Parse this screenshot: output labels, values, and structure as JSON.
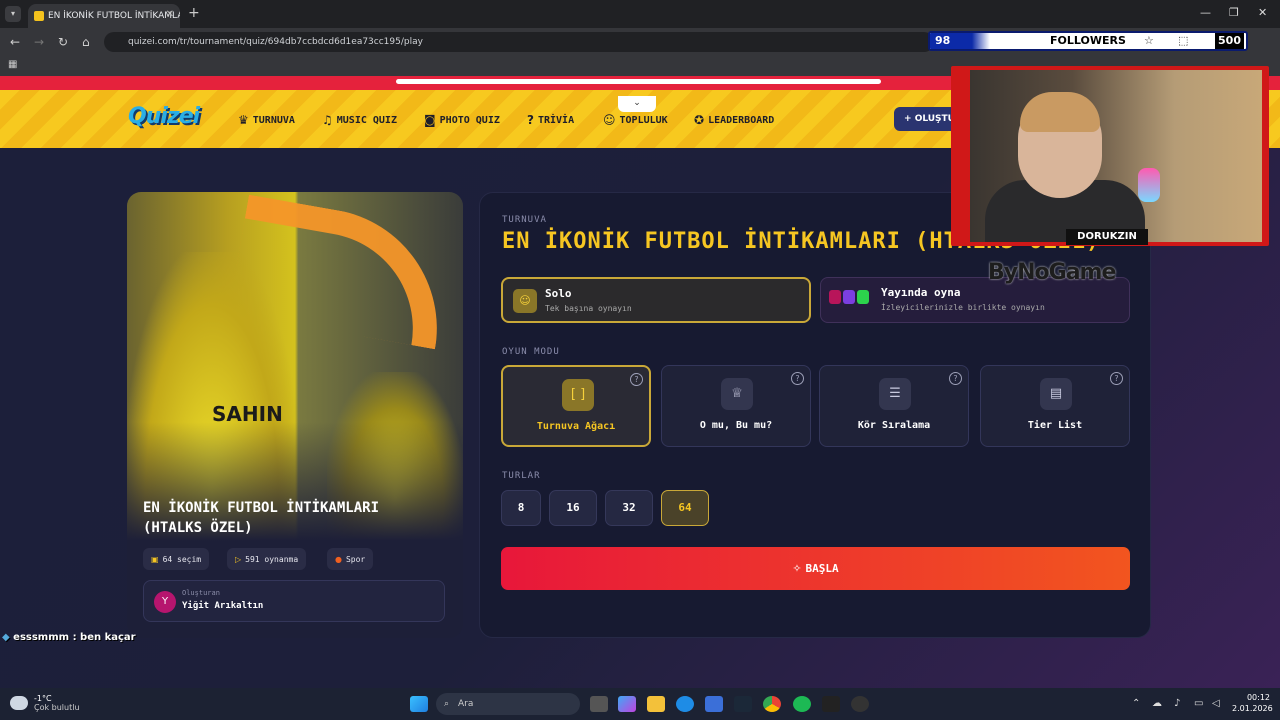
{
  "browser": {
    "tab_title": "EN İKONİK FUTBOL İNTİKAMLAR",
    "url": "quizei.com/tr/tournament/quiz/694db7ccbdcd6d1ea73cc195/play"
  },
  "overlay": {
    "followers_count": "98",
    "followers_label": "FOLLOWERS",
    "followers_goal": "500",
    "streamer_name": "DORUKZIN",
    "sponsor": "ByNoGame",
    "chat_user": "esssmmm",
    "chat_message": ": ben kaçar"
  },
  "site": {
    "logo": "Quizei",
    "nav": [
      "TURNUVA",
      "MUSIC QUIZ",
      "PHOTO QUIZ",
      "TRİVİA",
      "TOPLULUK",
      "LEADERBOARD"
    ],
    "create_label": "OLUŞTUR",
    "quiz": {
      "title": "EN İKONİK FUTBOL İNTİKAMLARI (HTALKS ÖZEL)",
      "jersey_text": "SAHIN",
      "choices": "64 seçim",
      "plays": "591 oynanma",
      "category": "Spor",
      "creator_label": "Oluşturan",
      "creator_name": "Yiğit Arıkaltın",
      "creator_initial": "Y"
    },
    "panel": {
      "section_label": "TURNUVA",
      "title": "EN İKONİK FUTBOL İNTİKAMLARI (HTALKS ÖZEL)",
      "solo_title": "Solo",
      "solo_sub": "Tek başına oynayın",
      "stream_title": "Yayında oyna",
      "stream_sub": "İzleyicilerinizle birlikte oynayın",
      "mode_label": "OYUN MODU",
      "modes": [
        "Turnuva Ağacı",
        "O mu, Bu mu?",
        "Kör Sıralama",
        "Tier List"
      ],
      "rounds_label": "TURLAR",
      "rounds": [
        "8",
        "16",
        "32",
        "64"
      ],
      "selected_round": "64",
      "start_label": "BAŞLA"
    }
  },
  "taskbar": {
    "temp": "-1°C",
    "weather": "Çok bulutlu",
    "search": "Ara",
    "time": "00:12",
    "date": "2.01.2026"
  }
}
